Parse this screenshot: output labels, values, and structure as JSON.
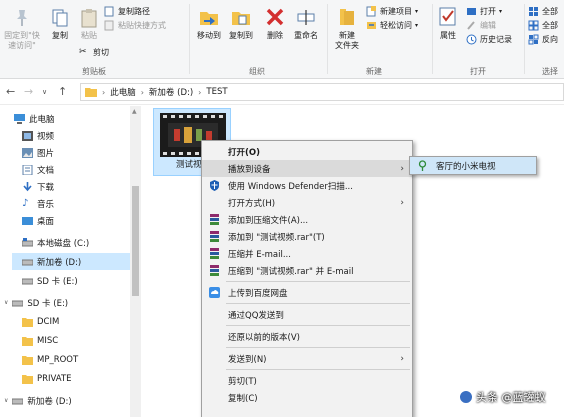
{
  "ribbon": {
    "clipboard": {
      "pin_label": "固定到\"快\n速访问\"",
      "copy_label": "复制",
      "paste_label": "粘贴",
      "copy_path": "复制路径",
      "paste_shortcut": "粘贴快捷方式",
      "cut": "剪切",
      "group_title": "剪贴板"
    },
    "organize": {
      "move_to": "移动到",
      "copy_to": "复制到",
      "delete": "删除",
      "rename": "重命名",
      "group_title": "组织"
    },
    "new": {
      "new_folder": "新建\n文件夹",
      "new_item": "新建项目",
      "easy_access": "轻松访问",
      "group_title": "新建"
    },
    "open": {
      "properties": "属性",
      "open": "打开",
      "edit": "编辑",
      "history": "历史记录",
      "group_title": "打开"
    },
    "select": {
      "select_all": "全部",
      "select_none": "全部",
      "invert": "反向",
      "group_title": "选择"
    }
  },
  "address": {
    "crumbs": [
      "此电脑",
      "新加卷 (D:)",
      "TEST"
    ]
  },
  "nav": {
    "items": [
      {
        "label": "此电脑"
      },
      {
        "label": "视频"
      },
      {
        "label": "图片"
      },
      {
        "label": "文档"
      },
      {
        "label": "下载"
      },
      {
        "label": "音乐"
      },
      {
        "label": "桌面"
      },
      {
        "label": "本地磁盘 (C:)"
      },
      {
        "label": "新加卷 (D:)"
      },
      {
        "label": "SD 卡 (E:)"
      },
      {
        "label": "SD 卡 (E:)"
      },
      {
        "label": "DCIM"
      },
      {
        "label": "MISC"
      },
      {
        "label": "MP_ROOT"
      },
      {
        "label": "PRIVATE"
      },
      {
        "label": "新加卷 (D:)"
      }
    ]
  },
  "file": {
    "name": "测试视"
  },
  "context_menu": {
    "items": [
      {
        "label": "打开(O)"
      },
      {
        "label": "播放到设备"
      },
      {
        "label": "使用 Windows Defender扫描..."
      },
      {
        "label": "打开方式(H)"
      },
      {
        "label": "添加到压缩文件(A)..."
      },
      {
        "label": "添加到 \"测试视频.rar\"(T)"
      },
      {
        "label": "压缩并 E-mail..."
      },
      {
        "label": "压缩到 \"测试视频.rar\" 并 E-mail"
      },
      {
        "label": "上传到百度网盘"
      },
      {
        "label": "通过QQ发送到"
      },
      {
        "label": "还原以前的版本(V)"
      },
      {
        "label": "发送到(N)"
      },
      {
        "label": "剪切(T)"
      },
      {
        "label": "复制(C)"
      }
    ],
    "submenu_item": "客厅的小米电视"
  },
  "watermark": {
    "text": "头条 @蓝罐蚁"
  },
  "colors": {
    "selection": "#cce8ff",
    "menu_bg": "#f2f2f2",
    "ribbon_bg": "#f5f6f7"
  }
}
